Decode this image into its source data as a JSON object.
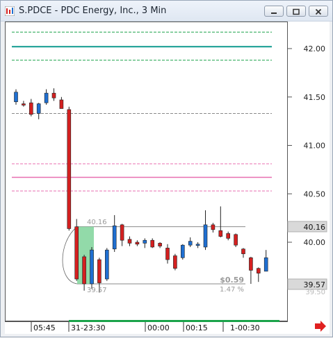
{
  "window": {
    "title": "S.PDCE - PDC Energy, Inc., 3 Min",
    "icon": "chart-app-icon"
  },
  "controls": {
    "minimize": "minimize-icon",
    "restore": "restore-icon",
    "close": "close-icon"
  },
  "colors": {
    "up_candle": "#1f6fd1",
    "down_candle": "#d42020",
    "green_line": "#1aa34a",
    "teal_line": "#0e9a8f",
    "pink_line": "#e86fb0",
    "gray_dash": "#8a8a8a",
    "selection": "#7fd49a",
    "arrow": "#e02020"
  },
  "price_axis": {
    "ticks": [
      "42.00",
      "41.50",
      "41.00",
      "40.50",
      "40.00"
    ],
    "current_price": "40.16",
    "low_marker": "39.57",
    "partial_label": "39.50"
  },
  "time_axis": {
    "labels": [
      "05:45",
      "31-23:30",
      "00:00",
      "00:15",
      "1-00:30"
    ]
  },
  "measurement": {
    "top_price": "40.16",
    "bottom_price": "39.57",
    "change": "$0.59",
    "percent": "1.47 %"
  },
  "chart_data": {
    "type": "candlestick",
    "title": "S.PDCE - PDC Energy, Inc., 3 Min",
    "ylim": [
      39.45,
      42.3
    ],
    "y_ticks": [
      42.0,
      41.5,
      41.0,
      40.5,
      40.0
    ],
    "grid": false,
    "candles": [
      {
        "o": 41.45,
        "h": 41.58,
        "l": 41.42,
        "c": 41.55
      },
      {
        "o": 41.43,
        "h": 41.46,
        "l": 41.4,
        "c": 41.42
      },
      {
        "o": 41.44,
        "h": 41.48,
        "l": 41.3,
        "c": 41.32
      },
      {
        "o": 41.33,
        "h": 41.44,
        "l": 41.27,
        "c": 41.43
      },
      {
        "o": 41.44,
        "h": 41.58,
        "l": 41.42,
        "c": 41.54
      },
      {
        "o": 41.54,
        "h": 41.59,
        "l": 41.46,
        "c": 41.49
      },
      {
        "o": 41.47,
        "h": 41.5,
        "l": 41.38,
        "c": 41.38
      },
      {
        "o": 41.37,
        "h": 41.4,
        "l": 40.12,
        "c": 40.14
      },
      {
        "o": 40.16,
        "h": 40.24,
        "l": 39.6,
        "c": 39.62
      },
      {
        "o": 39.85,
        "h": 39.87,
        "l": 39.5,
        "c": 39.57
      },
      {
        "o": 39.57,
        "h": 39.95,
        "l": 39.52,
        "c": 39.92
      },
      {
        "o": 39.82,
        "h": 39.84,
        "l": 39.48,
        "c": 39.58
      },
      {
        "o": 39.62,
        "h": 39.94,
        "l": 39.6,
        "c": 39.92
      },
      {
        "o": 39.93,
        "h": 40.28,
        "l": 39.9,
        "c": 40.17
      },
      {
        "o": 40.18,
        "h": 40.19,
        "l": 39.96,
        "c": 40.02
      },
      {
        "o": 40.03,
        "h": 40.06,
        "l": 39.96,
        "c": 39.99
      },
      {
        "o": 40.0,
        "h": 40.02,
        "l": 39.96,
        "c": 39.98
      },
      {
        "o": 39.99,
        "h": 40.04,
        "l": 39.94,
        "c": 40.02
      },
      {
        "o": 40.02,
        "h": 40.04,
        "l": 39.94,
        "c": 39.95
      },
      {
        "o": 39.99,
        "h": 40.0,
        "l": 39.94,
        "c": 39.96
      },
      {
        "o": 39.94,
        "h": 39.98,
        "l": 39.78,
        "c": 39.82
      },
      {
        "o": 39.86,
        "h": 39.88,
        "l": 39.71,
        "c": 39.73
      },
      {
        "o": 39.84,
        "h": 39.98,
        "l": 39.82,
        "c": 39.97
      },
      {
        "o": 39.97,
        "h": 40.05,
        "l": 39.95,
        "c": 40.01
      },
      {
        "o": 39.98,
        "h": 40.0,
        "l": 39.94,
        "c": 39.98
      },
      {
        "o": 39.95,
        "h": 40.33,
        "l": 39.92,
        "c": 40.18
      },
      {
        "o": 40.18,
        "h": 40.2,
        "l": 40.1,
        "c": 40.13
      },
      {
        "o": 40.12,
        "h": 40.37,
        "l": 40.05,
        "c": 40.06
      },
      {
        "o": 40.09,
        "h": 40.11,
        "l": 40.02,
        "c": 40.04
      },
      {
        "o": 40.08,
        "h": 40.09,
        "l": 39.95,
        "c": 39.97
      },
      {
        "o": 39.93,
        "h": 39.94,
        "l": 39.84,
        "c": 39.88
      },
      {
        "o": 39.84,
        "h": 39.85,
        "l": 39.57,
        "c": 39.71
      },
      {
        "o": 39.73,
        "h": 39.74,
        "l": 39.59,
        "c": 39.68
      },
      {
        "o": 39.7,
        "h": 39.92,
        "l": 39.7,
        "c": 39.84
      }
    ],
    "horizontal_lines": [
      {
        "price": 42.17,
        "style": "dashed",
        "color": "green"
      },
      {
        "price": 42.02,
        "style": "solid",
        "color": "teal"
      },
      {
        "price": 41.88,
        "style": "dashed",
        "color": "green"
      },
      {
        "price": 41.33,
        "style": "dashed",
        "color": "gray"
      },
      {
        "price": 40.81,
        "style": "dashed",
        "color": "pink"
      },
      {
        "price": 40.67,
        "style": "solid",
        "color": "pink"
      },
      {
        "price": 40.53,
        "style": "dashed",
        "color": "pink"
      },
      {
        "price": 40.16,
        "style": "solid",
        "color": "gray"
      },
      {
        "price": 39.57,
        "style": "solid",
        "color": "gray"
      }
    ]
  }
}
